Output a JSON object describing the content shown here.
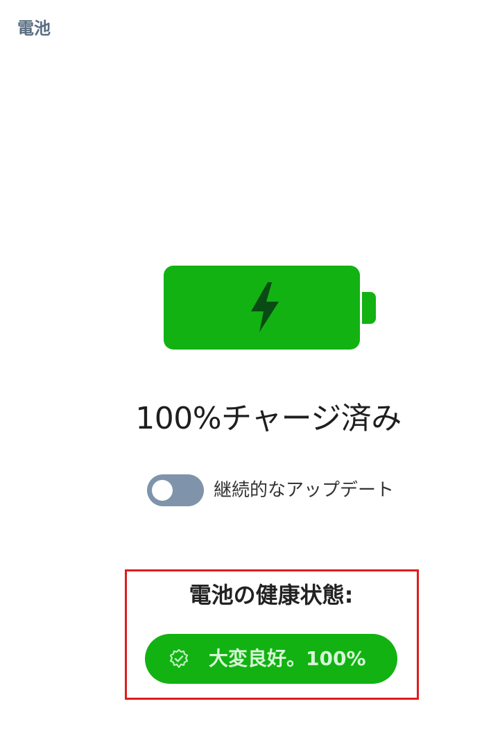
{
  "header": {
    "title": "電池"
  },
  "battery": {
    "level_percent": 100,
    "charging": true,
    "color": "#12b212",
    "icon": "lightning-bolt-icon"
  },
  "status": {
    "charge_text": "100%チャージ済み"
  },
  "continuous_update": {
    "label": "継続的なアップデート",
    "enabled": false
  },
  "health": {
    "title": "電池の健康状態:",
    "value": "大変良好。100%",
    "icon": "verified-badge-icon",
    "highlight_color": "#e01c1c"
  }
}
